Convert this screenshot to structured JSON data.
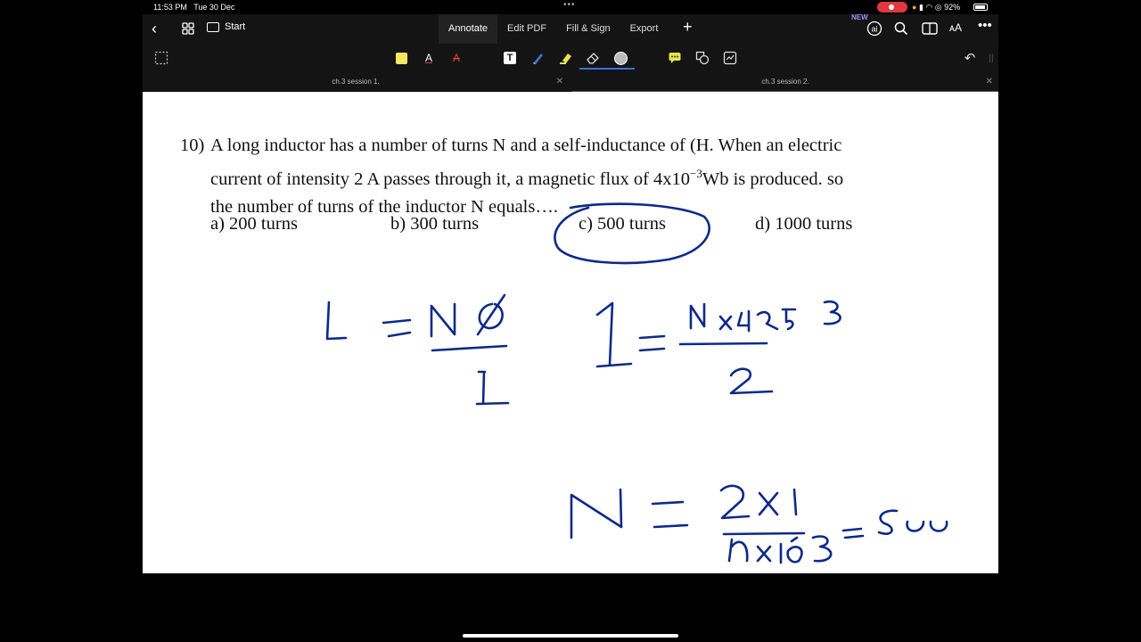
{
  "status": {
    "time": "11:53 PM",
    "date": "Tue 30 Dec",
    "battery": "92%"
  },
  "nav": {
    "start": "Start",
    "modes": [
      "Annotate",
      "Edit PDF",
      "Fill & Sign",
      "Export"
    ],
    "active_mode": "Annotate",
    "new_badge": "NEW",
    "ai_label": "ai"
  },
  "tools": {
    "colors": {
      "highlight": "#f5e663",
      "text_red": "#e03c3c",
      "pen": "#3d6fd6",
      "marker": "#e8e34a"
    },
    "text_tool": "T"
  },
  "doc_tabs": [
    {
      "title": "ch.3 session 1."
    },
    {
      "title": "ch.3 session 2."
    }
  ],
  "document": {
    "question_number": "10)",
    "line1": "A long inductor has a number of turns N and a self-inductance of (H. When an electric",
    "line2_a": "current of intensity 2 A passes through it, a magnetic flux of 4x10",
    "line2_exp": "−3",
    "line2_b": "Wb is produced. so",
    "line3": "the number of turns of the inductor N equals….",
    "options": [
      {
        "label": "a)   200 turns"
      },
      {
        "label": "b) 300 turns"
      },
      {
        "label": "c) 500 turns"
      },
      {
        "label": "d) 1000 turns"
      }
    ],
    "ink_color": "#0b2a8a"
  }
}
